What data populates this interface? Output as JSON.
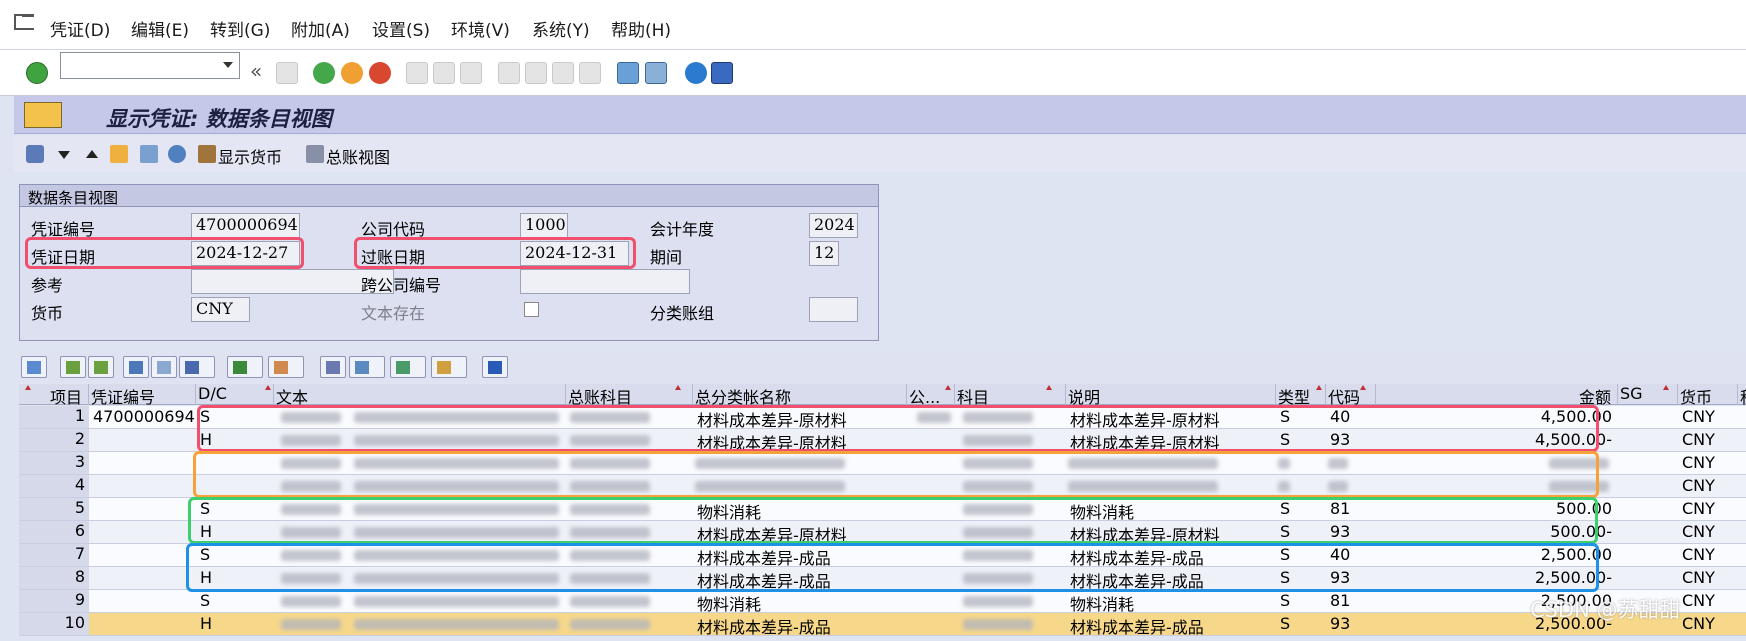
{
  "menu": [
    "凭证(D)",
    "编辑(E)",
    "转到(G)",
    "附加(A)",
    "设置(S)",
    "环境(V)",
    "系统(Y)",
    "帮助(H)"
  ],
  "toolbar": {
    "command_field": ""
  },
  "title": "显示凭证: 数据条目视图",
  "app_toolbar": {
    "display_currency": "显示货币",
    "gl_view": "总账视图"
  },
  "header": {
    "group_title": "数据条目视图",
    "doc_no_label": "凭证编号",
    "doc_no": "4700000694",
    "company_code_label": "公司代码",
    "company_code": "1000",
    "fiscal_year_label": "会计年度",
    "fiscal_year": "2024",
    "doc_date_label": "凭证日期",
    "doc_date": "2024-12-27",
    "posting_date_label": "过账日期",
    "posting_date": "2024-12-31",
    "period_label": "期间",
    "period": "12",
    "reference_label": "参考",
    "reference": "",
    "cross_company_label": "跨公司编号",
    "cross_company": "",
    "currency_label": "货币",
    "currency": "CNY",
    "text_exists_label": "文本存在",
    "ledger_group_label": "分类账组",
    "ledger_group": ""
  },
  "table": {
    "columns": [
      "项目",
      "凭证编号",
      "D/C",
      "文本",
      "总账科目",
      "总分类帐名称",
      "公...",
      "科目",
      "说明",
      "类型",
      "代码",
      "金额",
      "SG",
      "货币",
      "税"
    ],
    "rows": [
      {
        "item": "1",
        "doc": "4700000694",
        "dc": "S",
        "gl_name": "材料成本差异-原材料",
        "desc": "材料成本差异-原材料",
        "type": "S",
        "code": "40",
        "amount": "4,500.00",
        "cur": "CNY"
      },
      {
        "item": "2",
        "doc": "",
        "dc": "H",
        "gl_name": "材料成本差异-原材料",
        "desc": "材料成本差异-原材料",
        "type": "S",
        "code": "93",
        "amount": "4,500.00-",
        "cur": "CNY"
      },
      {
        "item": "3",
        "doc": "",
        "dc": "",
        "gl_name": "",
        "desc": "",
        "type": "",
        "code": "",
        "amount": "",
        "cur": "CNY"
      },
      {
        "item": "4",
        "doc": "",
        "dc": "",
        "gl_name": "",
        "desc": "",
        "type": "",
        "code": "",
        "amount": "",
        "cur": "CNY"
      },
      {
        "item": "5",
        "doc": "",
        "dc": "S",
        "gl_name": "物料消耗",
        "desc": "物料消耗",
        "type": "S",
        "code": "81",
        "amount": "500.00",
        "cur": "CNY"
      },
      {
        "item": "6",
        "doc": "",
        "dc": "H",
        "gl_name": "材料成本差异-原材料",
        "desc": "材料成本差异-原材料",
        "type": "S",
        "code": "93",
        "amount": "500.00-",
        "cur": "CNY"
      },
      {
        "item": "7",
        "doc": "",
        "dc": "S",
        "gl_name": "材料成本差异-成品",
        "desc": "材料成本差异-成品",
        "type": "S",
        "code": "40",
        "amount": "2,500.00",
        "cur": "CNY"
      },
      {
        "item": "8",
        "doc": "",
        "dc": "H",
        "gl_name": "材料成本差异-成品",
        "desc": "材料成本差异-成品",
        "type": "S",
        "code": "93",
        "amount": "2,500.00-",
        "cur": "CNY"
      },
      {
        "item": "9",
        "doc": "",
        "dc": "S",
        "gl_name": "物料消耗",
        "desc": "物料消耗",
        "type": "S",
        "code": "81",
        "amount": "2,500.00",
        "cur": "CNY"
      },
      {
        "item": "10",
        "doc": "",
        "dc": "H",
        "gl_name": "材料成本差异-成品",
        "desc": "材料成本差异-成品",
        "type": "S",
        "code": "93",
        "amount": "2,500.00-",
        "cur": "CNY"
      }
    ]
  },
  "watermark": "CSDN @苏甜甜",
  "colors": {
    "red": "#f0506e",
    "orange": "#f5a23a",
    "green": "#3ccf6e",
    "blue": "#1e90e6"
  }
}
